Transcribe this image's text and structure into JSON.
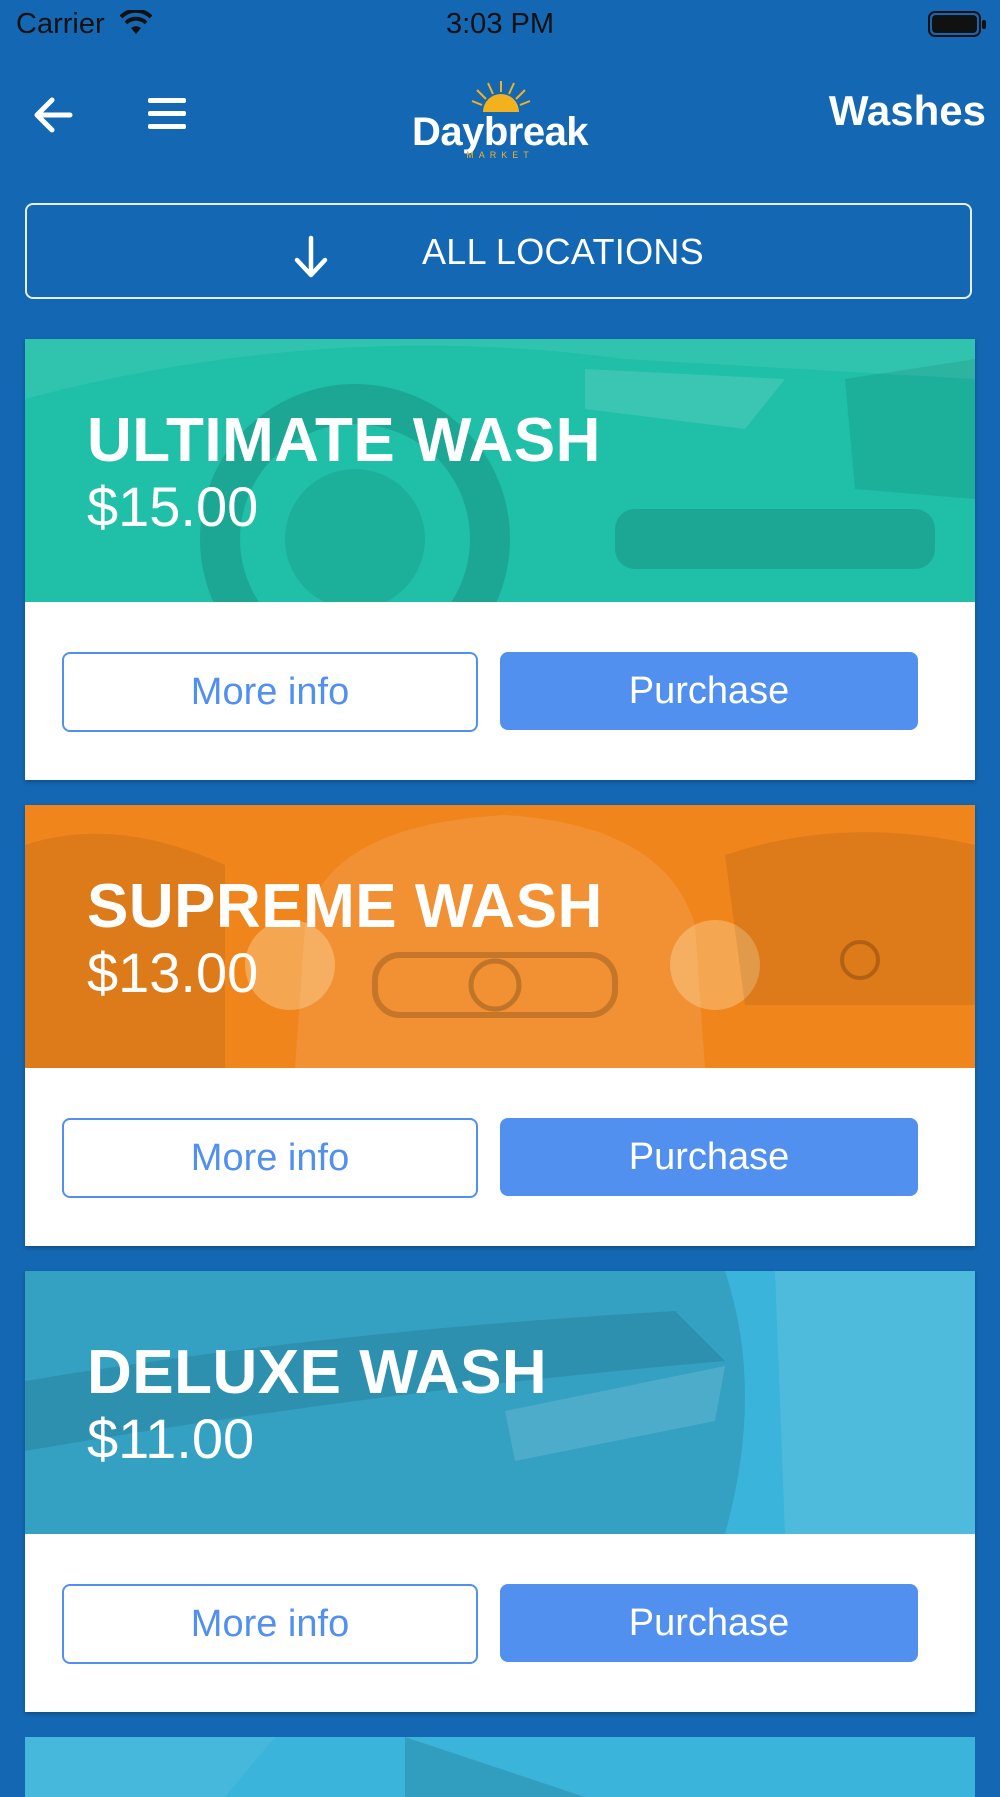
{
  "status_bar": {
    "carrier": "Carrier",
    "time": "3:03 PM"
  },
  "header": {
    "title": "Washes",
    "logo_text": "Daybreak",
    "logo_subtext": "MARKET",
    "icons": [
      "back-arrow-icon",
      "hamburger-menu-icon"
    ]
  },
  "location_filter": {
    "label": "ALL LOCATIONS",
    "icon": "arrow-down-icon"
  },
  "washes": [
    {
      "name": "ULTIMATE WASH",
      "price": "$15.00",
      "color": "#1fbfa8",
      "more_label": "More info",
      "purchase_label": "Purchase"
    },
    {
      "name": "SUPREME WASH",
      "price": "$13.00",
      "color": "#f0851c",
      "more_label": "More info",
      "purchase_label": "Purchase"
    },
    {
      "name": "DELUXE WASH",
      "price": "$11.00",
      "color": "#3ab4da",
      "more_label": "More info",
      "purchase_label": "Purchase"
    }
  ],
  "colors": {
    "background": "#1467b3",
    "accent": "#5290ef",
    "logo_accent": "#f3b21d"
  }
}
